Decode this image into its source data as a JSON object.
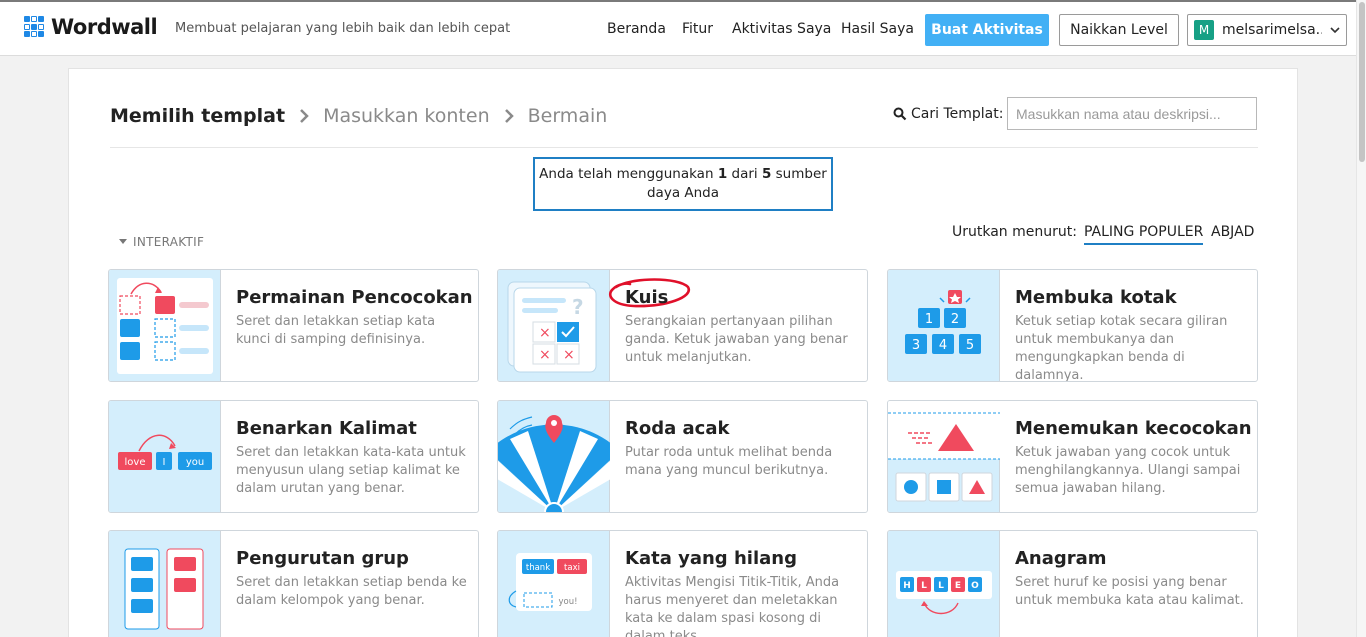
{
  "topbar": {
    "logo_text": "Wordwall",
    "tagline": "Membuat pelajaran yang lebih baik dan lebih cepat",
    "nav": [
      "Beranda",
      "Fitur",
      "Aktivitas Saya",
      "Hasil Saya"
    ],
    "create_button": "Buat Aktivitas",
    "upgrade_button": "Naikkan Level",
    "user_initial": "M",
    "user_name": "melsarimelsa..."
  },
  "breadcrumb": [
    "Memilih templat",
    "Masukkan konten",
    "Bermain"
  ],
  "search": {
    "label": "Cari Templat:",
    "placeholder": "Masukkan nama atau deskripsi..."
  },
  "quota": {
    "prefix": "Anda telah menggunakan ",
    "used": "1",
    "middle": " dari ",
    "total": "5",
    "suffix_line1": " sumber",
    "line2": "daya Anda"
  },
  "section": {
    "label": "INTERAKTIF"
  },
  "sort": {
    "label": "Urutkan menurut:",
    "options": [
      "PALING POPULER",
      "ABJAD"
    ],
    "active": "PALING POPULER"
  },
  "colors": {
    "accent": "#42b0f5",
    "thumb_bg": "#d4eefc",
    "red": "#f04a5e",
    "blue": "#1e9be8",
    "annotation": "#e0102a"
  },
  "templates": [
    {
      "title": "Permainan Pencocokan",
      "desc": "Seret dan letakkan setiap kata kunci di samping definisinya.",
      "icon": "match-up-icon"
    },
    {
      "title": "Kuis",
      "desc": "Serangkaian pertanyaan pilihan ganda. Ketuk jawaban yang benar untuk melanjutkan.",
      "icon": "quiz-icon"
    },
    {
      "title": "Membuka kotak",
      "desc": "Ketuk setiap kotak secara giliran untuk membukanya dan mengungkapkan benda di dalamnya.",
      "icon": "open-box-icon",
      "box_numbers": [
        "1",
        "2",
        "3",
        "4",
        "5"
      ]
    },
    {
      "title": "Benarkan Kalimat",
      "desc": "Seret dan letakkan kata-kata untuk menyusun ulang setiap kalimat ke dalam urutan yang benar.",
      "icon": "unjumble-icon",
      "words": [
        "love",
        "I",
        "you"
      ]
    },
    {
      "title": "Roda acak",
      "desc": "Putar roda untuk melihat benda mana yang muncul berikutnya.",
      "icon": "random-wheel-icon"
    },
    {
      "title": "Menemukan kecocokan",
      "desc": "Ketuk jawaban yang cocok untuk menghilangkannya. Ulangi sampai semua jawaban hilang.",
      "icon": "find-match-icon"
    },
    {
      "title": "Pengurutan grup",
      "desc": "Seret dan letakkan setiap benda ke dalam kelompok yang benar.",
      "icon": "group-sort-icon"
    },
    {
      "title": "Kata yang hilang",
      "desc": "Aktivitas Mengisi Titik-Titik, Anda harus menyeret dan meletakkan kata ke dalam spasi kosong di dalam teks.",
      "icon": "missing-word-icon",
      "words": [
        "thank",
        "taxi",
        "you!"
      ]
    },
    {
      "title": "Anagram",
      "desc": "Seret huruf ke posisi yang benar untuk membuka kata atau kalimat.",
      "icon": "anagram-icon",
      "letters": [
        "H",
        "L",
        "L",
        "E",
        "O"
      ]
    }
  ]
}
